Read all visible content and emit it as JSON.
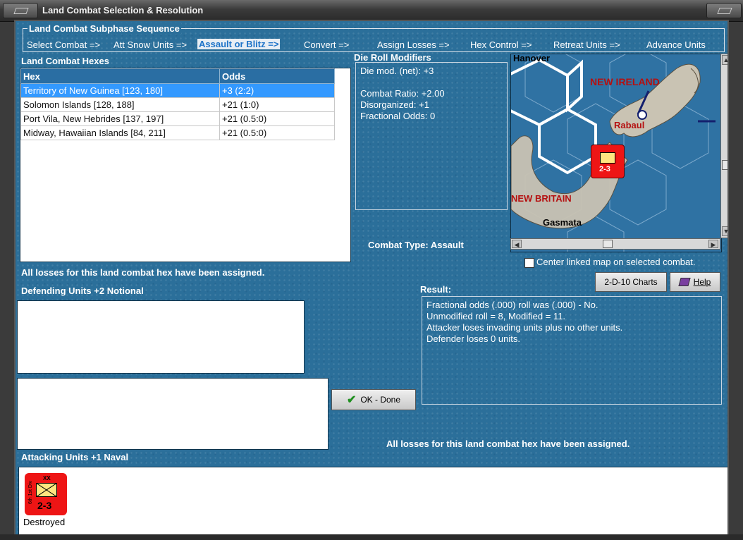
{
  "window": {
    "title": "Land Combat Selection & Resolution"
  },
  "sequence": {
    "legend": "Land Combat Subphase Sequence",
    "steps": [
      {
        "label": "Select Combat =>",
        "active": false
      },
      {
        "label": "Att Snow Units =>",
        "active": false
      },
      {
        "label": "Assault or Blitz =>",
        "active": true
      },
      {
        "label": "Convert =>",
        "active": false
      },
      {
        "label": "Assign Losses =>",
        "active": false
      },
      {
        "label": "Hex Control =>",
        "active": false
      },
      {
        "label": "Retreat Units =>",
        "active": false
      },
      {
        "label": "Advance Units",
        "active": false
      }
    ]
  },
  "hexes": {
    "heading": "Land Combat Hexes",
    "columns": [
      "Hex",
      "Odds"
    ],
    "rows": [
      {
        "hex": "Territory of New Guinea [123, 180]",
        "odds": "+3 (2:2)",
        "selected": true
      },
      {
        "hex": "Solomon Islands [128, 188]",
        "odds": "+21 (1:0)",
        "selected": false
      },
      {
        "hex": "Port Vila, New Hebrides [137, 197]",
        "odds": "+21 (0.5:0)",
        "selected": false
      },
      {
        "hex": "Midway, Hawaiian Islands [84, 211]",
        "odds": "+21 (0.5:0)",
        "selected": false
      }
    ]
  },
  "modifiers": {
    "heading": "Die Roll Modifiers",
    "lines": [
      "Die mod. (net): +3",
      "",
      "Combat Ratio: +2.00",
      "Disorganized: +1",
      "Fractional Odds: 0"
    ]
  },
  "combat_type": "Combat Type:  Assault",
  "map": {
    "labels": {
      "hanover": "Hanover",
      "new_ireland": "NEW IRELAND",
      "rabaul": "Rabaul",
      "new_britain": "NEW BRITAIN",
      "gasmata": "Gasmata"
    },
    "counter_strength": "2-3",
    "center_linked_label": "Center linked map on selected combat."
  },
  "messages": {
    "losses_assigned_top": "All losses for this land combat hex have been assigned.",
    "losses_assigned_bottom": "All losses for this land combat hex have been assigned."
  },
  "defending": {
    "heading": "Defending Units +2 Notional"
  },
  "attacking": {
    "heading": "Attacking Units +1 Naval",
    "units": [
      {
        "strength": "2-3",
        "size": "XX",
        "side_text": "6th 1st Div",
        "status": "Destroyed"
      }
    ]
  },
  "buttons": {
    "charts": "2-D-10 Charts",
    "help": "Help",
    "ok": "OK - Done"
  },
  "result": {
    "heading": "Result:",
    "lines": [
      "Fractional odds (.000) roll was (.000)  - No.",
      "Unmodified roll = 8, Modified = 11.",
      "Attacker loses invading units plus no other units.",
      "Defender loses 0 units."
    ]
  },
  "colors": {
    "panel": "#2b6f9a",
    "selected_row": "#3399ff",
    "unit_red": "#ee1515",
    "active_step": "#1f74c8"
  }
}
